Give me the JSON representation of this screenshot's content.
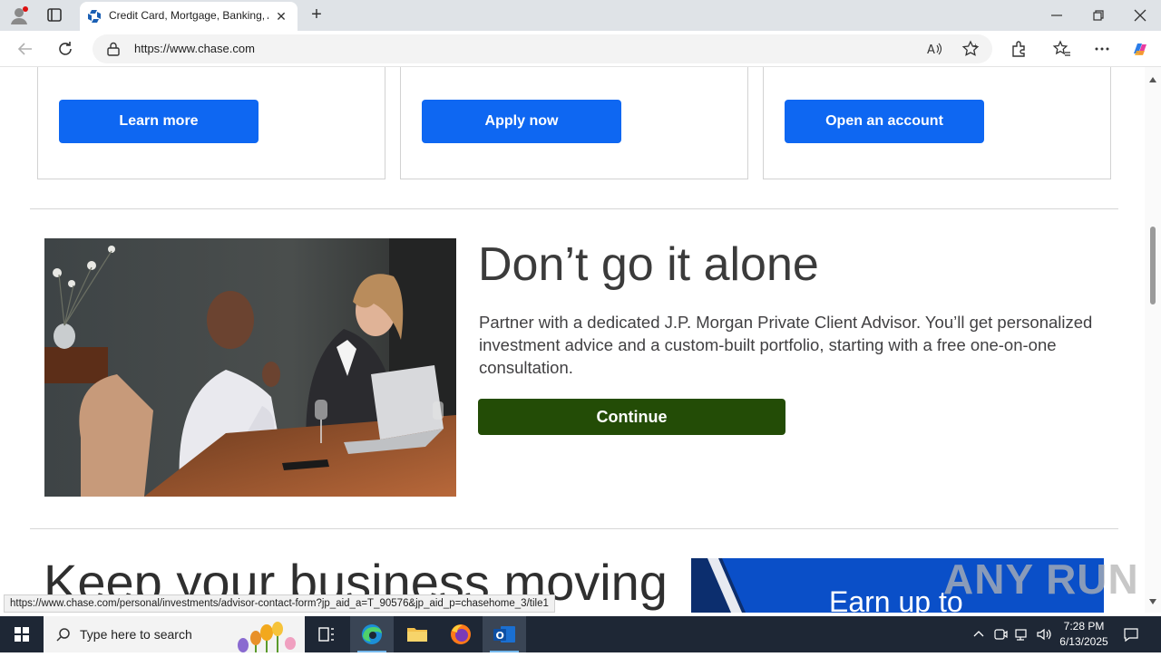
{
  "browser": {
    "tab_title": "Credit Card, Mortgage, Banking, Auto | Chase Online | Chase.com",
    "url": "https://www.chase.com",
    "status_url": "https://www.chase.com/personal/investments/advisor-contact-form?jp_aid_a=T_90576&jp_aid_p=chasehome_3/tile1"
  },
  "page": {
    "cards": [
      {
        "button": "Learn more"
      },
      {
        "button": "Apply now"
      },
      {
        "button": "Open an account"
      }
    ],
    "feature": {
      "headline": "Don’t go it alone",
      "body": "Partner with a dedicated J.P. Morgan Private Client Advisor. You’ll get personalized investment advice and a custom-built portfolio, starting with a free one-on-one consultation.",
      "button": "Continue"
    },
    "next_section": {
      "headline": "Keep your business moving",
      "promo_text": "Earn up to"
    },
    "watermark": "ANY RUN"
  },
  "taskbar": {
    "search_placeholder": "Type here to search",
    "time": "7:28 PM",
    "date": "6/13/2025"
  },
  "colors": {
    "chase_blue": "#0e67f2",
    "continue_green": "#234c06",
    "taskbar": "#1e2735"
  }
}
